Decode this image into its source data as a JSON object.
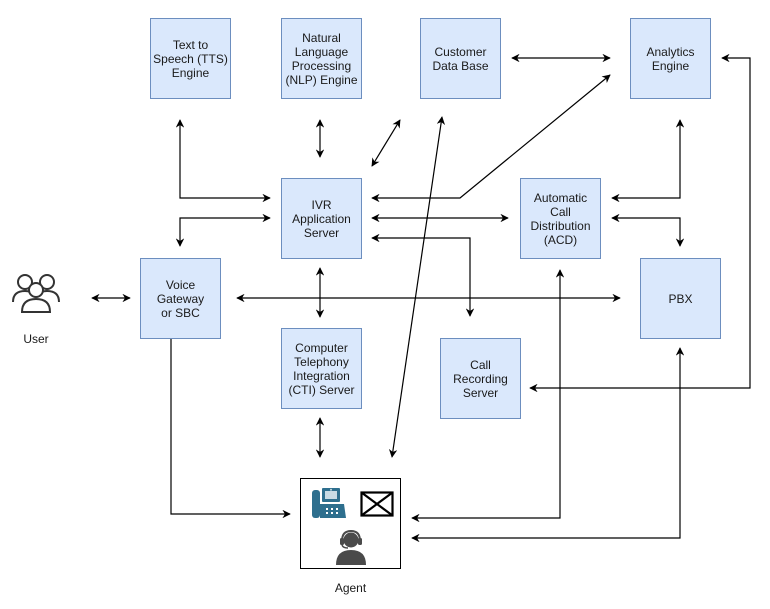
{
  "diagram": {
    "nodes": {
      "tts": "Text to\nSpeech (TTS)\nEngine",
      "nlp": "Natural\nLanguage\nProcessing\n(NLP) Engine",
      "customer_db": "Customer\nData Base",
      "analytics": "Analytics\nEngine",
      "ivr": "IVR\nApplication\nServer",
      "acd": "Automatic\nCall\nDistribution\n(ACD)",
      "voice_gateway": "Voice\nGateway\nor SBC",
      "pbx": "PBX",
      "cti": "Computer\nTelephony\nIntegration\n(CTI) Server",
      "call_recording": "Call\nRecording\nServer"
    },
    "actors": {
      "user": "User",
      "agent": "Agent"
    },
    "icons": {
      "user": "users-group-icon",
      "agent_phone": "desk-phone-icon",
      "agent_mail": "envelope-icon",
      "agent_person": "headset-agent-icon"
    },
    "colors": {
      "node_fill": "#dae8fc",
      "node_stroke": "#6c8ebf",
      "edge": "#000000",
      "phone_icon": "#2e6f8e",
      "agent_icon": "#4a4a4a"
    },
    "edges": [
      {
        "from": "User",
        "to": "Voice Gateway or SBC",
        "direction": "both"
      },
      {
        "from": "Text to Speech (TTS) Engine",
        "to": "IVR Application Server",
        "direction": "both"
      },
      {
        "from": "Voice Gateway or SBC",
        "to": "IVR Application Server",
        "direction": "both"
      },
      {
        "from": "Natural Language Processing (NLP) Engine",
        "to": "IVR Application Server",
        "direction": "both"
      },
      {
        "from": "Customer Data Base",
        "to": "IVR Application Server",
        "direction": "both"
      },
      {
        "from": "Customer Data Base",
        "to": "Analytics Engine",
        "direction": "both"
      },
      {
        "from": "IVR Application Server",
        "to": "Analytics Engine",
        "direction": "both"
      },
      {
        "from": "IVR Application Server",
        "to": "Automatic Call Distribution (ACD)",
        "direction": "both"
      },
      {
        "from": "IVR Application Server",
        "to": "Call Recording Server",
        "direction": "both"
      },
      {
        "from": "Automatic Call Distribution (ACD)",
        "to": "Analytics Engine",
        "direction": "both"
      },
      {
        "from": "Automatic Call Distribution (ACD)",
        "to": "PBX",
        "direction": "both"
      },
      {
        "from": "Voice Gateway or SBC",
        "to": "PBX",
        "direction": "both"
      },
      {
        "from": "IVR Application Server",
        "to": "Computer Telephony Integration (CTI) Server",
        "direction": "both"
      },
      {
        "from": "Computer Telephony Integration (CTI) Server",
        "to": "Agent",
        "direction": "both"
      },
      {
        "from": "Voice Gateway or SBC",
        "to": "Agent",
        "direction": "both"
      },
      {
        "from": "Agent",
        "to": "Customer Data Base",
        "direction": "both"
      },
      {
        "from": "Automatic Call Distribution (ACD)",
        "to": "Agent",
        "direction": "both"
      },
      {
        "from": "PBX",
        "to": "Agent",
        "direction": "both"
      },
      {
        "from": "Analytics Engine",
        "to": "Call Recording Server",
        "direction": "both"
      }
    ]
  }
}
